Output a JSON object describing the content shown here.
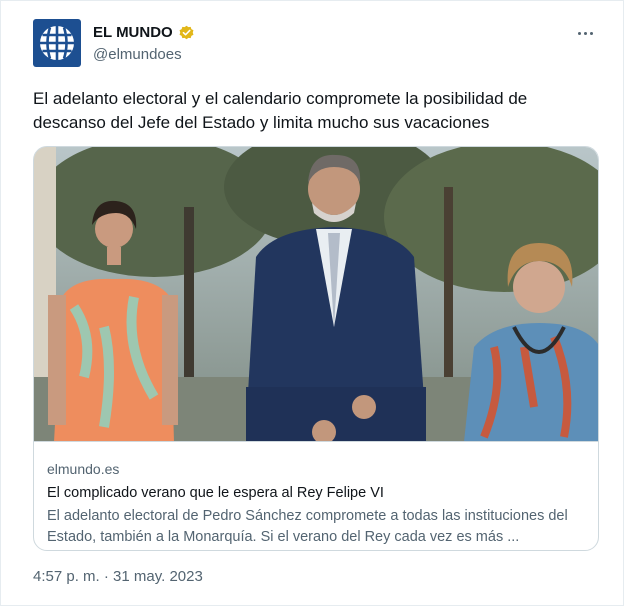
{
  "author": {
    "display_name": "EL MUNDO",
    "handle": "@elmundoes",
    "avatar_icon": "el-mundo-globe-logo",
    "verified_icon": "gold-verified-badge-icon",
    "verified_color": "#e2b719"
  },
  "menu": {
    "icon": "more-horizontal-icon"
  },
  "tweet": {
    "text": "El adelanto electoral y el calendario compromete la posibilidad de descanso del Jefe del Estado y limita mucho sus vacaciones"
  },
  "card": {
    "image_description": "photo-three-people-outdoors",
    "domain": "elmundo.es",
    "title": "El complicado verano que le espera al Rey Felipe VI",
    "description": "El adelanto electoral de Pedro Sánchez compromete a todas las instituciones del Estado, también a la Monarquía. Si el verano del Rey cada vez es más ..."
  },
  "timestamp": "4:57 p. m. · 31 may. 2023",
  "colors": {
    "text_primary": "#0f1419",
    "text_secondary": "#536471",
    "border": "#cfd9de",
    "brand_blue": "#1d4f91"
  }
}
